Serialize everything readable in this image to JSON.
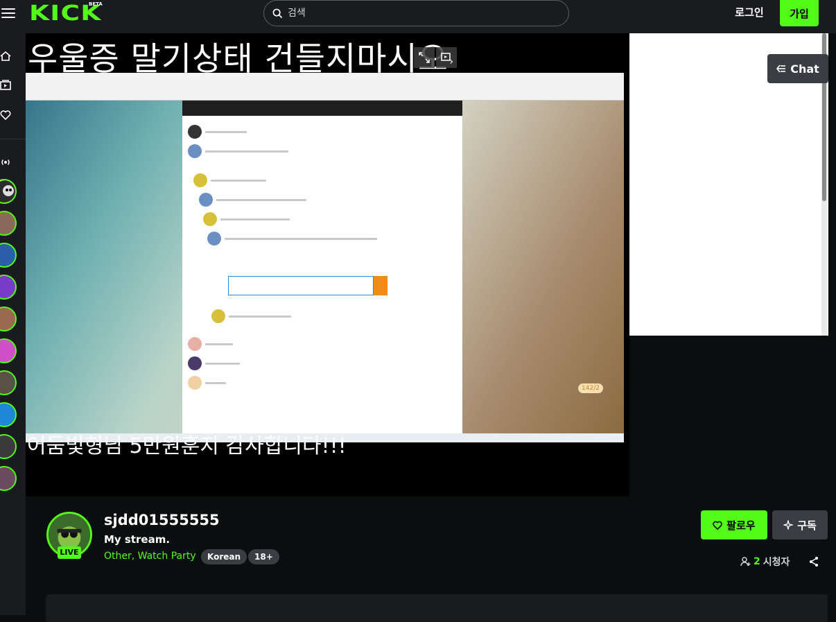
{
  "header": {
    "logo": "KICK",
    "logo_badge": "BETA",
    "search_placeholder": "검색",
    "login_label": "로그인",
    "signup_label": "가입"
  },
  "player": {
    "top_overlay_text": "우울증 말기상태 건들지마시오",
    "bottom_overlay_text": "어둠빛형님 5만원훈지 감사합니다!!!",
    "counter": "142/2"
  },
  "chat": {
    "button_label": "Chat"
  },
  "channel": {
    "username": "sjdd01555555",
    "live_label": "LIVE",
    "stream_title": "My stream.",
    "category": "Other, Watch Party",
    "tags": [
      "Korean",
      "18+"
    ],
    "follow_label": "팔로우",
    "subscribe_label": "구독",
    "viewer_count": "2",
    "viewer_label": "시청자"
  },
  "colors": {
    "brand": "#53fc18",
    "nav_bg": "#191b1f",
    "page_bg": "#0b0e0f"
  }
}
